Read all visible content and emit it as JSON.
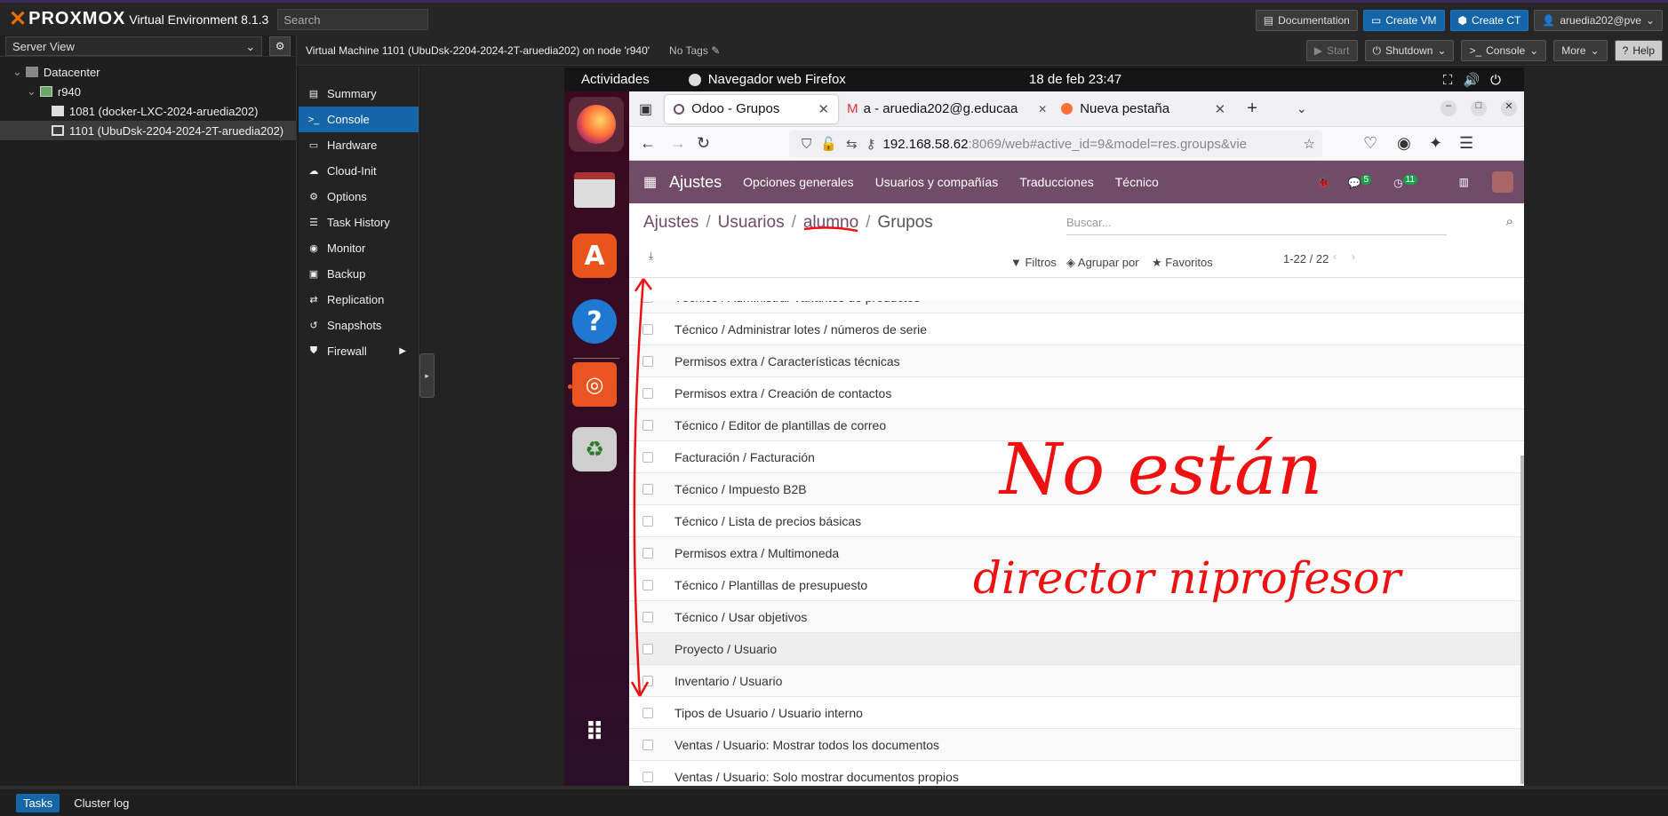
{
  "pve": {
    "logo": "PROXMOX",
    "version": "Virtual Environment 8.1.3",
    "search_placeholder": "Search",
    "top_buttons": [
      "Documentation",
      "Create VM",
      "Create CT",
      "aruedia202@pve"
    ],
    "server_view": "Server View",
    "tree": [
      "Datacenter",
      "r940",
      "1081 (docker-LXC-2024-aruedia202)",
      "1101 (UbuDsk-2204-2024-2T-aruedia202)"
    ],
    "vm_title": "Virtual Machine 1101 (UbuDsk-2204-2024-2T-aruedia202) on node 'r940'",
    "tags": "No Tags",
    "vm_buttons": [
      "Start",
      "Shutdown",
      "Console",
      "More",
      "Help"
    ],
    "menu": [
      "Summary",
      "Console",
      "Hardware",
      "Cloud-Init",
      "Options",
      "Task History",
      "Monitor",
      "Backup",
      "Replication",
      "Snapshots",
      "Firewall"
    ],
    "bottom_tabs": [
      "Tasks",
      "Cluster log"
    ]
  },
  "gnome": {
    "activities": "Actividades",
    "app": "Navegador web Firefox",
    "clock": "18 de feb  23:47"
  },
  "firefox": {
    "tabs": [
      "Odoo - Grupos",
      "a - aruedia202@g.educaa",
      "Nueva pestaña"
    ],
    "url_main": "192.168.58.62",
    "url_rest": ":8069/web#active_id=9&model=res.groups&vie"
  },
  "odoo": {
    "app": "Ajustes",
    "menus": [
      "Opciones generales",
      "Usuarios y compañías",
      "Traducciones",
      "Técnico"
    ],
    "msg_badge": "5",
    "act_badge": "11",
    "crumbs": [
      "Ajustes",
      "Usuarios",
      "alumno",
      "Grupos"
    ],
    "search_placeholder": "Buscar...",
    "filters": "Filtros",
    "group_by": "Agrupar por",
    "favorites": "Favoritos",
    "pager": "1-22 / 22",
    "rows": [
      "Técnico / Administrar variantes de productos",
      "Técnico / Administrar lotes / números de serie",
      "Permisos extra / Características técnicas",
      "Permisos extra / Creación de contactos",
      "Técnico / Editor de plantillas de correo",
      "Facturación / Facturación",
      "Técnico / Impuesto B2B",
      "Técnico / Lista de precios básicas",
      "Permisos extra / Multimoneda",
      "Técnico / Plantillas de presupuesto",
      "Técnico / Usar objetivos",
      "Proyecto / Usuario",
      "Inventario / Usuario",
      "Tipos de Usuario / Usuario interno",
      "Ventas / Usuario: Mostrar todos los documentos",
      "Ventas / Usuario: Solo mostrar documentos propios"
    ]
  },
  "annotation": {
    "line1": "No están",
    "line2": "director niprofesor"
  }
}
